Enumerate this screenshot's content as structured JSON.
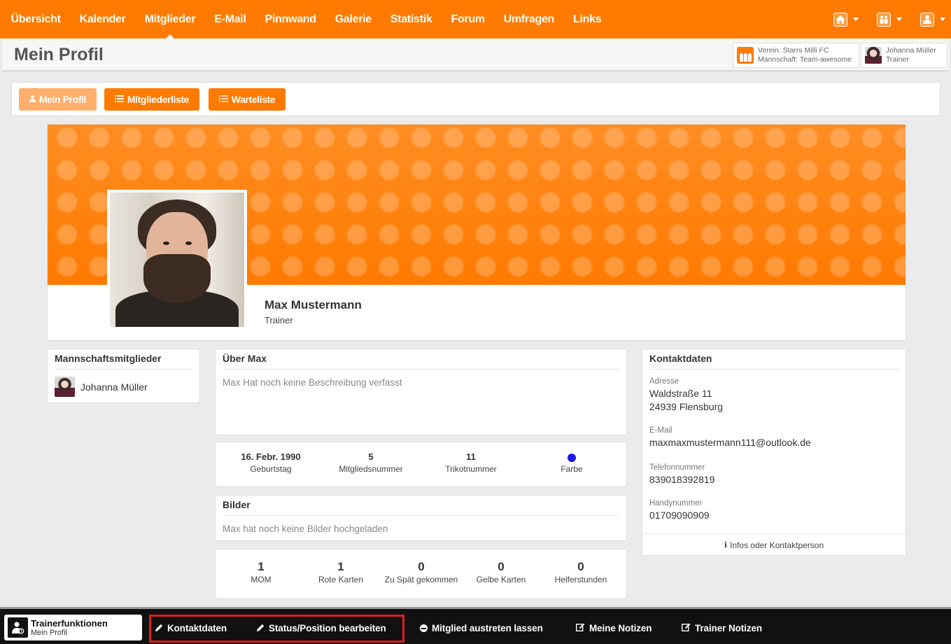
{
  "nav": {
    "items": [
      {
        "label": "Übersicht"
      },
      {
        "label": "Kalender"
      },
      {
        "label": "Mitglieder"
      },
      {
        "label": "E-Mail"
      },
      {
        "label": "Pinnwand"
      },
      {
        "label": "Galerie"
      },
      {
        "label": "Statistik"
      },
      {
        "label": "Forum"
      },
      {
        "label": "Umfragen"
      },
      {
        "label": "Links"
      }
    ],
    "active": "Mitglieder",
    "right_icons": [
      "home-icon",
      "team-icon",
      "user-icon"
    ]
  },
  "header": {
    "title": "Mein Profil",
    "club_line1": "Verein: Starrs Milli FC",
    "club_line2": "Mannschaft: Team-awesome",
    "user_name": "Johanna Müller",
    "user_role": "Trainer"
  },
  "buttons": {
    "profile": "Mein Profil",
    "members_list": "Mitgliederliste",
    "waiting_list": "Warteliste"
  },
  "profile": {
    "name": "Max Mustermann",
    "role": "Trainer"
  },
  "team_members": {
    "title": "Mannschaftsmitglieder",
    "members": [
      {
        "name": "Johanna Müller"
      }
    ]
  },
  "about": {
    "title": "Über Max",
    "text": "Max Hat noch keine Beschreibung verfasst"
  },
  "details": [
    {
      "value": "16. Febr. 1990",
      "label": "Geburtstag"
    },
    {
      "value": "5",
      "label": "Mitgliedsnummer"
    },
    {
      "value": "11",
      "label": "Trikotnummer"
    },
    {
      "value": "",
      "label": "Farbe",
      "color": "#1d18e6"
    }
  ],
  "pictures": {
    "title": "Bilder",
    "text": "Max hat noch keine Bilder hochgeladen"
  },
  "stats": [
    {
      "value": "1",
      "label": "MOM"
    },
    {
      "value": "1",
      "label": "Rote Karten"
    },
    {
      "value": "0",
      "label": "Zu Spät gekommen"
    },
    {
      "value": "0",
      "label": "Gelbe Karten"
    },
    {
      "value": "0",
      "label": "Helferstunden"
    }
  ],
  "contact": {
    "title": "Kontaktdaten",
    "address_label": "Adresse",
    "address_line1": "Waldstraße 11",
    "address_line2": "24939 Flensburg",
    "email_label": "E-Mail",
    "email": "maxmaxmustermann111@outlook.de",
    "phone_label": "Telefonnummer",
    "phone": "839018392819",
    "mobile_label": "Handynummer",
    "mobile": "01709090909",
    "footer": "Infos oder Kontaktperson"
  },
  "bottombar": {
    "title": "Trainerfunktionen",
    "subtitle": "Mein Profil",
    "actions": [
      {
        "label": "Kontaktdaten",
        "icon": "pencil-icon"
      },
      {
        "label": "Status/Position bearbeiten",
        "icon": "pencil-icon"
      },
      {
        "label": "Mitglied austreten lassen",
        "icon": "minus-circle-icon"
      },
      {
        "label": "Meine Notizen",
        "icon": "edit-icon"
      },
      {
        "label": "Trainer Notizen",
        "icon": "edit-icon"
      }
    ]
  },
  "colors": {
    "brand_orange": "#ff7a00",
    "highlight_red": "#e31b1b",
    "bottom_bar": "#111111"
  }
}
